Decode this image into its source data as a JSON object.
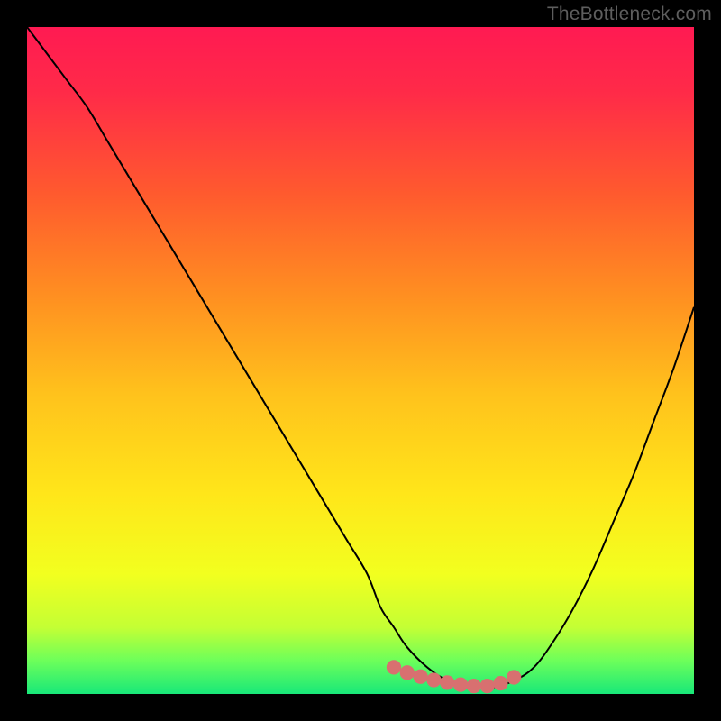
{
  "watermark": "TheBottleneck.com",
  "gradient_stops": [
    {
      "offset": 0.0,
      "color": "#ff1a52"
    },
    {
      "offset": 0.1,
      "color": "#ff2b48"
    },
    {
      "offset": 0.25,
      "color": "#ff5a2e"
    },
    {
      "offset": 0.4,
      "color": "#ff8e21"
    },
    {
      "offset": 0.55,
      "color": "#ffc21c"
    },
    {
      "offset": 0.7,
      "color": "#ffe61a"
    },
    {
      "offset": 0.82,
      "color": "#f2ff1f"
    },
    {
      "offset": 0.9,
      "color": "#c4ff34"
    },
    {
      "offset": 0.95,
      "color": "#6dff5a"
    },
    {
      "offset": 1.0,
      "color": "#18e879"
    }
  ],
  "colors": {
    "curve": "#000000",
    "marker": "#d87070",
    "background": "#000000"
  },
  "chart_data": {
    "type": "line",
    "title": "",
    "xlabel": "",
    "ylabel": "",
    "xlim": [
      0,
      100
    ],
    "ylim": [
      0,
      100
    ],
    "x": [
      0,
      3,
      6,
      9,
      12,
      15,
      18,
      21,
      24,
      27,
      30,
      33,
      36,
      39,
      42,
      45,
      48,
      51,
      53,
      55,
      57,
      60,
      63,
      66,
      68,
      70,
      73,
      76,
      79,
      82,
      85,
      88,
      91,
      94,
      97,
      100
    ],
    "y": [
      100,
      96,
      92,
      88,
      83,
      78,
      73,
      68,
      63,
      58,
      53,
      48,
      43,
      38,
      33,
      28,
      23,
      18,
      13,
      10,
      7,
      4,
      2,
      1,
      1,
      1,
      2,
      4,
      8,
      13,
      19,
      26,
      33,
      41,
      49,
      58
    ],
    "markers": {
      "x": [
        55,
        57,
        59,
        61,
        63,
        65,
        67,
        69,
        71,
        73
      ],
      "y": [
        4.0,
        3.2,
        2.6,
        2.1,
        1.7,
        1.4,
        1.2,
        1.2,
        1.6,
        2.5
      ]
    }
  }
}
